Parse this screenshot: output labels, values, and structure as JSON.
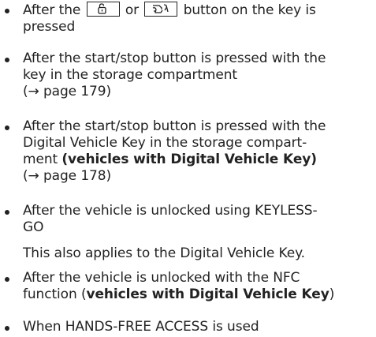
{
  "items": [
    {
      "line1_before": "After the",
      "line1_or": "or",
      "line1_after": "button on the key is",
      "line2": "pressed",
      "icon_lock": "unlock-key-icon",
      "icon_trunk": "tailgate-key-icon"
    },
    {
      "line1": "After the start/stop button is pressed with the",
      "line2": "key in the storage compartment",
      "line3": "(→ page 179)"
    },
    {
      "line1": "After the start/stop button is pressed with the",
      "line2": "Digital Vehicle Key in the storage compart-",
      "line3_plain": "ment ",
      "line3_bold": "(vehicles with Digital Vehicle Key)",
      "line4": "(→ page 178)"
    },
    {
      "line1": "After the vehicle is unlocked using KEYLESS-",
      "line2": "GO",
      "note": "This also applies to the Digital Vehicle Key."
    },
    {
      "line1": "After the vehicle is unlocked with the NFC",
      "line2_plain_a": "function (",
      "line2_bold": "vehicles with Digital Vehicle Key",
      "line2_plain_b": ")"
    },
    {
      "line1": "When HANDS-FREE ACCESS is used"
    }
  ]
}
